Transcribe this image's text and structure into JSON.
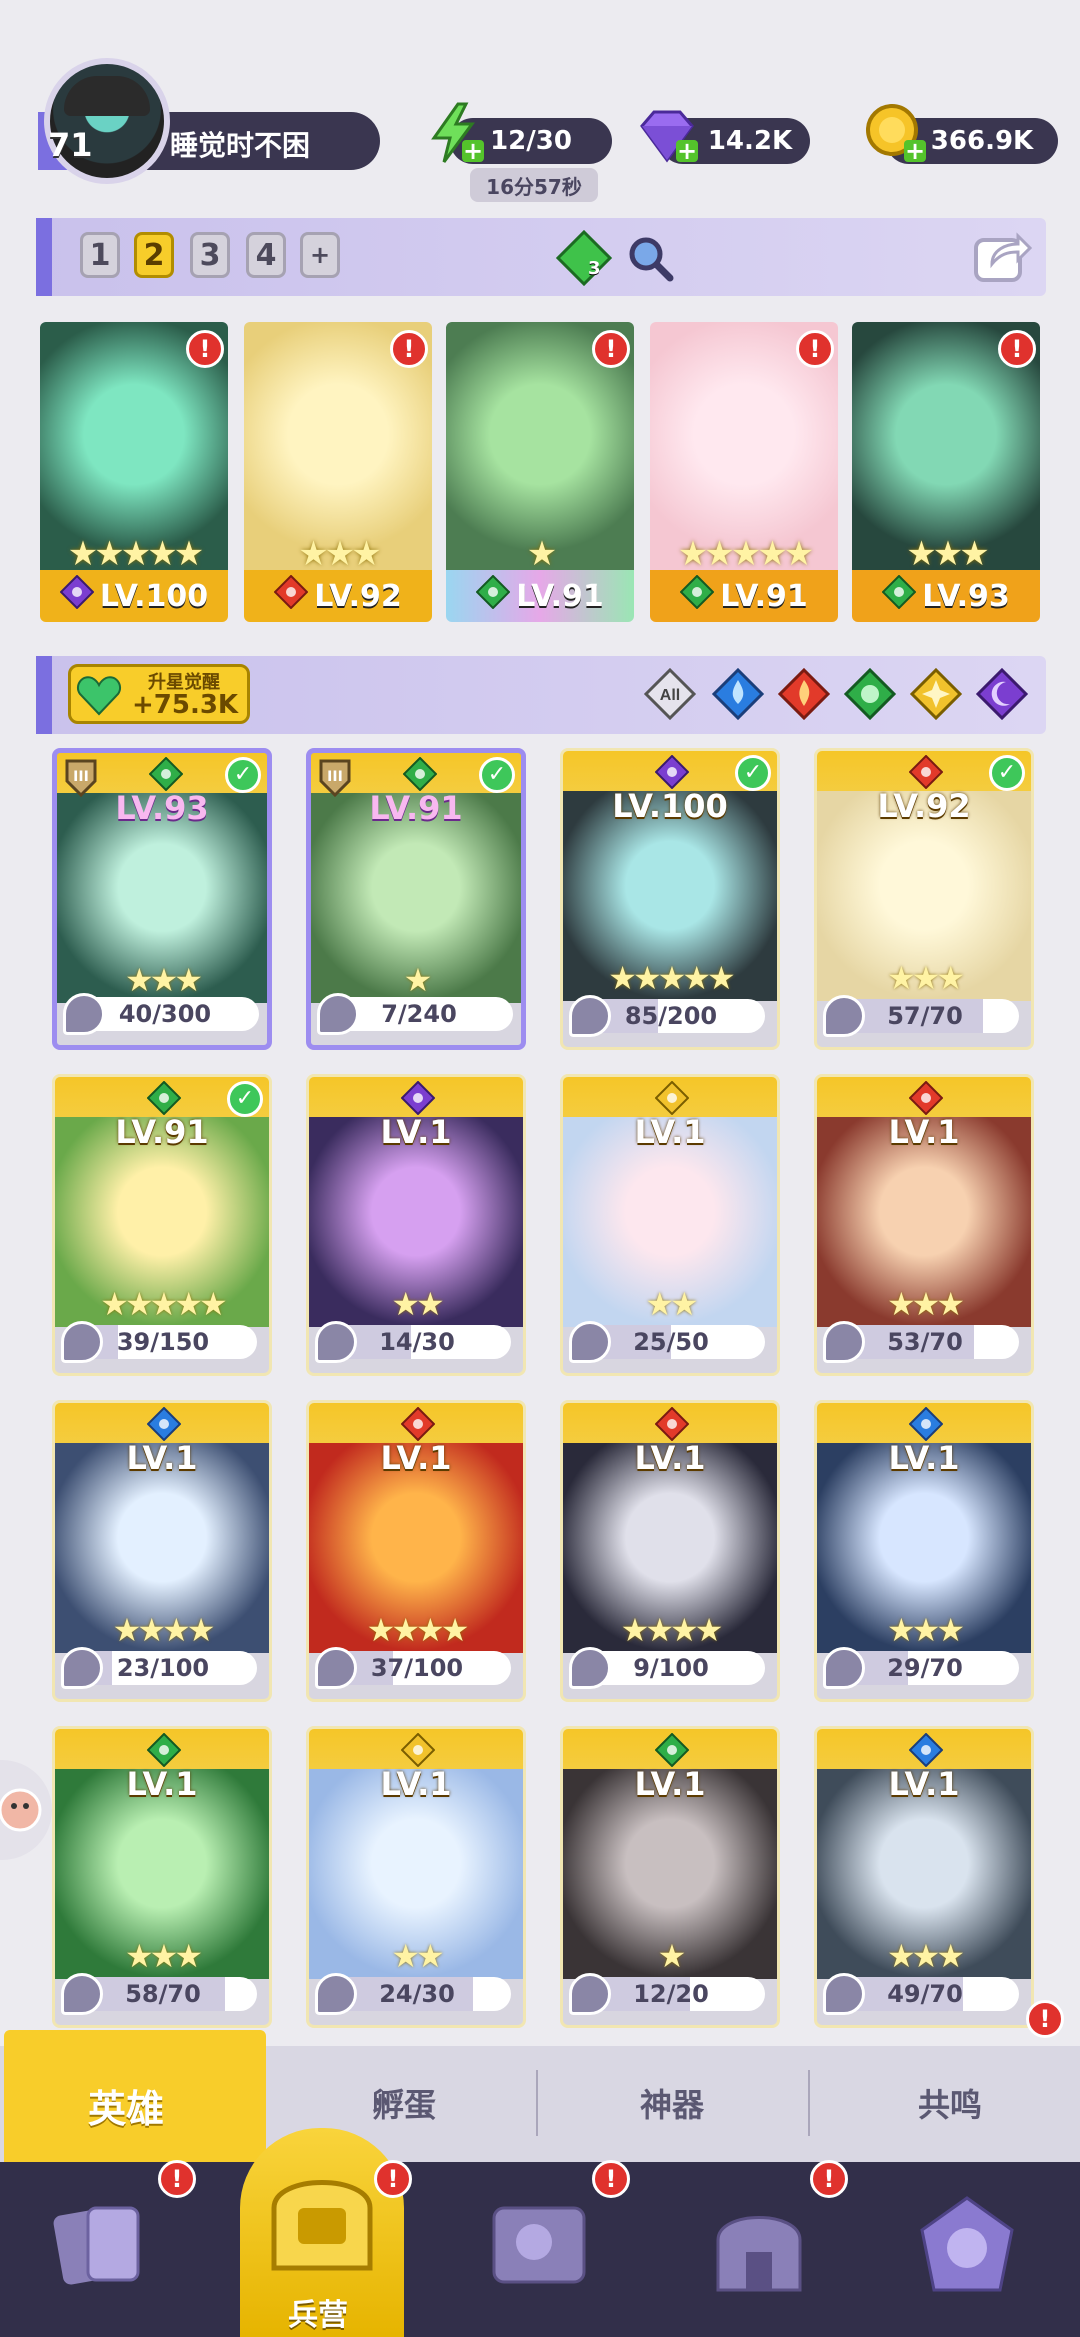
{
  "player": {
    "level": "71",
    "name": "睡觉时不困"
  },
  "resources": {
    "energy": "12/30",
    "energy_timer": "16分57秒",
    "gems": "14.2K",
    "coins": "366.9K"
  },
  "teams": {
    "tabs": [
      "1",
      "2",
      "3",
      "4",
      "+"
    ],
    "active_index": 1,
    "gem_badge_count": "3"
  },
  "formation": [
    {
      "level": "LV.100",
      "stars": "★★★★★",
      "element": "dark",
      "alert": "!"
    },
    {
      "level": "LV.92",
      "stars": "★★★",
      "element": "fire",
      "alert": "!"
    },
    {
      "level": "LV.91",
      "stars": "★",
      "element": "earth",
      "alert": "!"
    },
    {
      "level": "LV.91",
      "stars": "★★★★★",
      "element": "earth",
      "alert": "!"
    },
    {
      "level": "LV.93",
      "stars": "★★★",
      "element": "earth",
      "alert": "!"
    }
  ],
  "awaken": {
    "label": "升星觉醒",
    "value": "+75.3K"
  },
  "element_filters": [
    "All",
    "water",
    "fire",
    "earth",
    "light",
    "dark"
  ],
  "heroes": [
    {
      "level": "LV.93",
      "progress": "40/300",
      "fill": 0.13,
      "stars": "★★★",
      "element": "earth",
      "checked": true
    },
    {
      "level": "LV.91",
      "progress": "7/240",
      "fill": 0.03,
      "stars": "★",
      "element": "earth",
      "checked": true
    },
    {
      "level": "LV.100",
      "progress": "85/200",
      "fill": 0.43,
      "stars": "★★★★★",
      "element": "dark",
      "checked": true
    },
    {
      "level": "LV.92",
      "progress": "57/70",
      "fill": 0.81,
      "stars": "★★★",
      "element": "fire",
      "checked": true
    },
    {
      "level": "LV.91",
      "progress": "39/150",
      "fill": 0.26,
      "stars": "★★★★★",
      "element": "earth",
      "checked": true
    },
    {
      "level": "LV.1",
      "progress": "14/30",
      "fill": 0.47,
      "stars": "★★",
      "element": "dark",
      "checked": false
    },
    {
      "level": "LV.1",
      "progress": "25/50",
      "fill": 0.5,
      "stars": "★★",
      "element": "light",
      "checked": false
    },
    {
      "level": "LV.1",
      "progress": "53/70",
      "fill": 0.76,
      "stars": "★★★",
      "element": "fire",
      "checked": false
    },
    {
      "level": "LV.1",
      "progress": "23/100",
      "fill": 0.23,
      "stars": "★★★★",
      "element": "water",
      "checked": false
    },
    {
      "level": "LV.1",
      "progress": "37/100",
      "fill": 0.37,
      "stars": "★★★★",
      "element": "fire",
      "checked": false
    },
    {
      "level": "LV.1",
      "progress": "9/100",
      "fill": 0.09,
      "stars": "★★★★",
      "element": "fire",
      "checked": false
    },
    {
      "level": "LV.1",
      "progress": "29/70",
      "fill": 0.41,
      "stars": "★★★",
      "element": "water",
      "checked": false
    },
    {
      "level": "LV.1",
      "progress": "58/70",
      "fill": 0.83,
      "stars": "★★★",
      "element": "earth",
      "checked": false
    },
    {
      "level": "LV.1",
      "progress": "24/30",
      "fill": 0.8,
      "stars": "★★",
      "element": "light",
      "checked": false
    },
    {
      "level": "LV.1",
      "progress": "12/20",
      "fill": 0.6,
      "stars": "★",
      "element": "earth",
      "checked": false
    },
    {
      "level": "LV.1",
      "progress": "49/70",
      "fill": 0.7,
      "stars": "★★★",
      "element": "water",
      "checked": false
    }
  ],
  "subtabs": {
    "heroes": "英雄",
    "hatch": "孵蛋",
    "artifact": "神器",
    "resonance": "共鸣"
  },
  "nav": {
    "barracks": "兵营"
  },
  "colors": {
    "accent": "#7b6fe0",
    "gold": "#f8cd2a",
    "dark": "#322f4a",
    "alert": "#e0322d"
  }
}
